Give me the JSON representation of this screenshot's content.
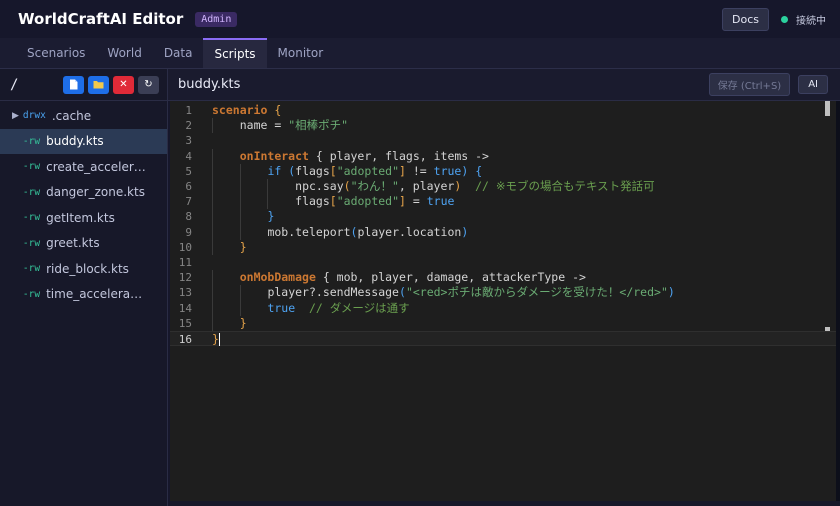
{
  "header": {
    "title": "WorldCraftAI Editor",
    "badge": "Admin",
    "docs_label": "Docs",
    "status_text": "接続中",
    "status_color": "#2bd19e"
  },
  "tabs": [
    {
      "label": "Scenarios",
      "active": false
    },
    {
      "label": "World",
      "active": false
    },
    {
      "label": "Data",
      "active": false
    },
    {
      "label": "Scripts",
      "active": true
    },
    {
      "label": "Monitor",
      "active": false
    }
  ],
  "sidebar": {
    "cwd": "/",
    "tools": {
      "new_file_icon": "file-plus-icon",
      "new_folder_icon": "folder-plus-icon",
      "delete_symbol": "✕",
      "refresh_symbol": "↻"
    },
    "files": [
      {
        "perm": "drwx",
        "name": ".cache",
        "type": "dir"
      },
      {
        "perm": "-rw",
        "name": "buddy.kts",
        "selected": true
      },
      {
        "perm": "-rw",
        "name": "create_accelera…"
      },
      {
        "perm": "-rw",
        "name": "danger_zone.kts"
      },
      {
        "perm": "-rw",
        "name": "getItem.kts"
      },
      {
        "perm": "-rw",
        "name": "greet.kts"
      },
      {
        "perm": "-rw",
        "name": "ride_block.kts"
      },
      {
        "perm": "-rw",
        "name": "time_accelerati…"
      }
    ]
  },
  "editor": {
    "filename": "buddy.kts",
    "save_label": "保存 (Ctrl+S)",
    "ai_label": "AI",
    "line_numbers": [
      "1",
      "2",
      "3",
      "4",
      "5",
      "6",
      "7",
      "8",
      "9",
      "10",
      "11",
      "12",
      "13",
      "14",
      "15",
      "16"
    ],
    "lines": [
      {
        "tokens": [
          {
            "t": "scenario",
            "c": "kw"
          },
          {
            "t": " {",
            "c": "kw2"
          }
        ]
      },
      {
        "tokens": [
          {
            "t": "name = "
          },
          {
            "t": "\"相棒ポチ\"",
            "c": "str"
          }
        ]
      },
      {
        "tokens": []
      },
      {
        "tokens": [
          {
            "t": "onInteract",
            "c": "kw"
          },
          {
            "t": " { player, flags, items ->"
          }
        ]
      },
      {
        "tokens": [
          {
            "t": "if (",
            "c": "blue"
          },
          {
            "t": "flags"
          },
          {
            "t": "[",
            "c": "kw2"
          },
          {
            "t": "\"adopted\"",
            "c": "str"
          },
          {
            "t": "]",
            "c": "kw2"
          },
          {
            "t": " != "
          },
          {
            "t": "true",
            "c": "blue"
          },
          {
            "t": ") {",
            "c": "blue"
          }
        ]
      },
      {
        "tokens": [
          {
            "t": "npc.say"
          },
          {
            "t": "(",
            "c": "kw2"
          },
          {
            "t": "\"わん！\"",
            "c": "str"
          },
          {
            "t": ", player"
          },
          {
            "t": ")",
            "c": "kw2"
          },
          {
            "t": "  // ※モブの場合もテキスト発話可",
            "c": "cmt"
          }
        ]
      },
      {
        "tokens": [
          {
            "t": "flags"
          },
          {
            "t": "[",
            "c": "kw2"
          },
          {
            "t": "\"adopted\"",
            "c": "str"
          },
          {
            "t": "]",
            "c": "kw2"
          },
          {
            "t": " = "
          },
          {
            "t": "true",
            "c": "blue"
          }
        ]
      },
      {
        "tokens": [
          {
            "t": "}",
            "c": "blue"
          }
        ]
      },
      {
        "tokens": [
          {
            "t": "mob.teleport"
          },
          {
            "t": "(",
            "c": "blue"
          },
          {
            "t": "player.location"
          },
          {
            "t": ")",
            "c": "blue"
          }
        ]
      },
      {
        "tokens": [
          {
            "t": "}",
            "c": "kw2"
          }
        ]
      },
      {
        "tokens": []
      },
      {
        "tokens": [
          {
            "t": "onMobDamage",
            "c": "kw"
          },
          {
            "t": " { mob, player, damage, attackerType ->"
          }
        ]
      },
      {
        "tokens": [
          {
            "t": "player?.sendMessage"
          },
          {
            "t": "(",
            "c": "blue"
          },
          {
            "t": "\"<red>ポチは敵からダメージを受けた！</red>\"",
            "c": "str"
          },
          {
            "t": ")",
            "c": "blue"
          }
        ]
      },
      {
        "tokens": [
          {
            "t": "true",
            "c": "blue"
          },
          {
            "t": "  // ダメージは通す",
            "c": "cmt"
          }
        ]
      },
      {
        "tokens": [
          {
            "t": "}",
            "c": "kw2"
          }
        ]
      },
      {
        "tokens": [
          {
            "t": "}",
            "c": "kw2"
          }
        ]
      }
    ]
  }
}
